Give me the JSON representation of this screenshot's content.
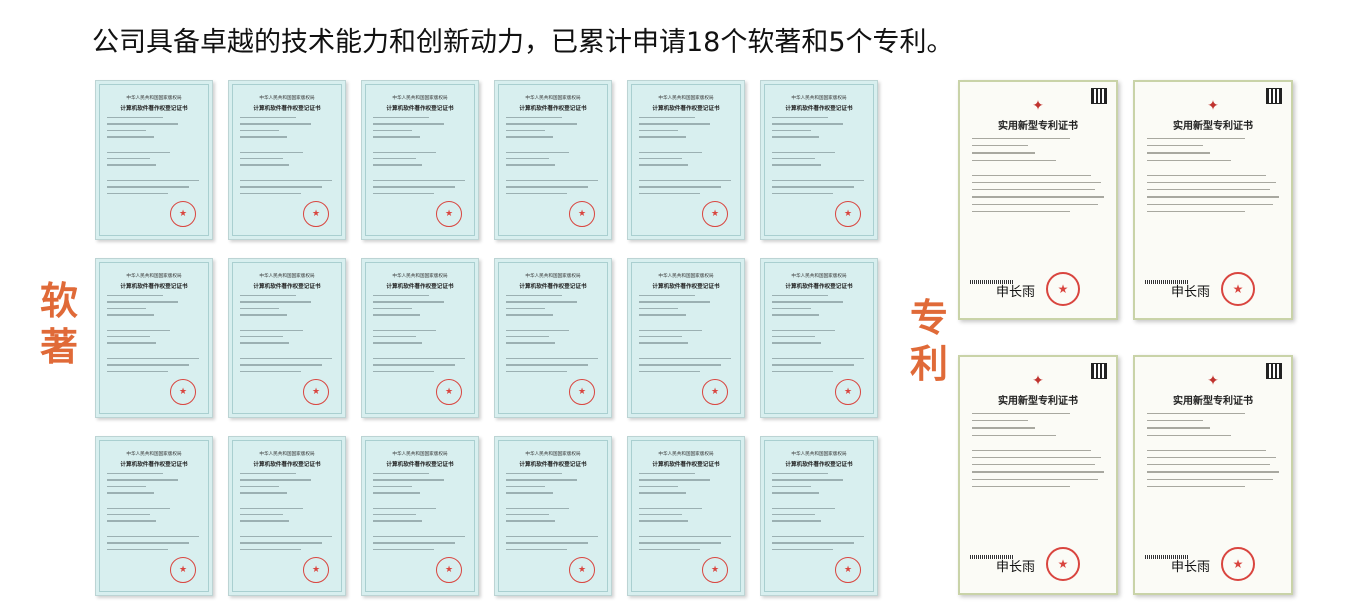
{
  "headline": "公司具备卓越的技术能力和创新动力，已累计申请18个软著和5个专利。",
  "labels": {
    "software": "软著",
    "patent": "专利"
  },
  "software_certificate": {
    "issuer": "中华人民共和国国家版权局",
    "title": "计算机软件著作权登记证书",
    "seal_glyph": "★"
  },
  "patent_certificate": {
    "title": "实用新型专利证书",
    "emblem_glyph": "✦",
    "seal_glyph": "★",
    "signature": "申长雨"
  },
  "colors": {
    "accent": "#e06a38",
    "software_bg": "#d8efef",
    "seal_red": "#d9453f"
  }
}
